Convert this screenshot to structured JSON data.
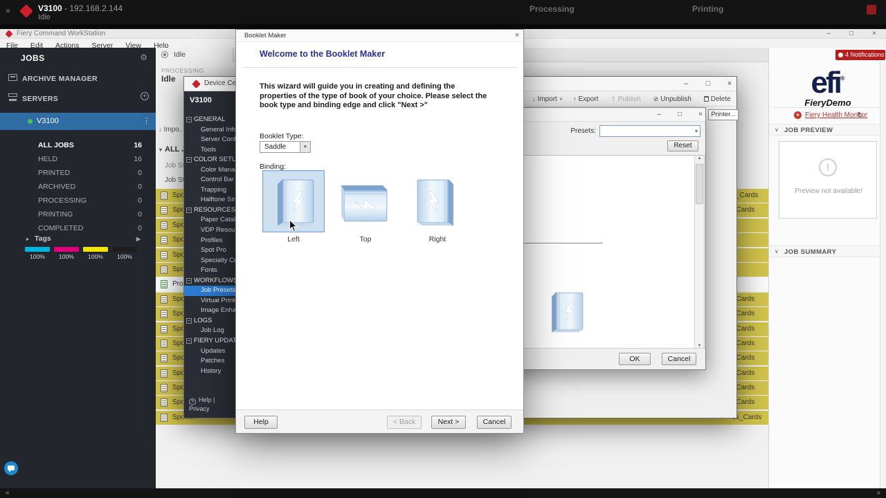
{
  "colors": {
    "fiery_red": "#cf1f2e",
    "selection_blue": "#2b7cd3",
    "server_selected_blue": "#2e6ca3",
    "heading_blue": "#2c2f8e",
    "job_row_yellow": "#d2c34c",
    "notification_red": "#b71c1c"
  },
  "system_bar": {
    "expand_icon": "»",
    "server_name": "V3100",
    "server_ip": "- 192.168.2.144",
    "status": "Idle",
    "processing_label": "Processing",
    "printing_label": "Printing"
  },
  "app_window": {
    "title": "Fiery Command WorkStation",
    "menus": [
      "File",
      "Edit",
      "Actions",
      "Server",
      "View",
      "Help"
    ]
  },
  "sidebar": {
    "jobs_header": "JOBS",
    "archive_manager_label": "ARCHIVE MANAGER",
    "servers_header": "SERVERS",
    "server_name": "V3100",
    "categories": [
      {
        "label": "ALL JOBS",
        "count": "16",
        "selected": true
      },
      {
        "label": "HELD",
        "count": "16"
      },
      {
        "label": "PRINTED",
        "count": "0"
      },
      {
        "label": "ARCHIVED",
        "count": "0"
      },
      {
        "label": "PROCESSING",
        "count": "0"
      },
      {
        "label": "PRINTING",
        "count": "0"
      },
      {
        "label": "COMPLETED",
        "count": "0"
      }
    ],
    "tags_label": "Tags",
    "ink_levels": [
      {
        "name": "cyan",
        "color": "#00b5e2",
        "percent": "100%"
      },
      {
        "name": "magenta",
        "color": "#e6007e",
        "percent": "100%"
      },
      {
        "name": "yellow",
        "color": "#f2e400",
        "percent": "100%"
      },
      {
        "name": "black",
        "color": "#1f1f1f",
        "percent": "100%"
      }
    ]
  },
  "job_center": {
    "tab_label": "Idle",
    "processing_label": "PROCESSING",
    "status": "Idle",
    "import_button_label": "Impo...",
    "group_header": "ALL J...",
    "column_header_top": "Job Status",
    "column_header": "Job Status",
    "rows": [
      {
        "label": "Spoo...",
        "name": "s_Cards",
        "type": "spooled"
      },
      {
        "label": "Spoo...",
        "name": "_Cards",
        "type": "spooled"
      },
      {
        "label": "Spoo...",
        "name": "",
        "type": "spooled"
      },
      {
        "label": "Spoo...",
        "name": "",
        "type": "spooled"
      },
      {
        "label": "Spoo...",
        "name": "",
        "type": "spooled"
      },
      {
        "label": "Spoo...",
        "name": "",
        "type": "spooled"
      },
      {
        "label": "Proc...",
        "name": "",
        "type": "processed"
      },
      {
        "label": "Spoo...",
        "name": "_Cards",
        "type": "spooled"
      },
      {
        "label": "Spoo...",
        "name": "_Cards",
        "type": "spooled"
      },
      {
        "label": "Spoo...",
        "name": "_Cards",
        "type": "spooled"
      },
      {
        "label": "Spoo...",
        "name": "_Cards",
        "type": "spooled"
      },
      {
        "label": "Spoo...",
        "name": "_Cards",
        "type": "spooled"
      },
      {
        "label": "Spoo...",
        "name": "_Cards",
        "type": "spooled"
      },
      {
        "label": "Spoo...",
        "name": "_Cards",
        "type": "spooled"
      },
      {
        "label": "Spoo...",
        "name": "_Cards",
        "type": "spooled"
      },
      {
        "label": "Spoo...",
        "name": "ss_Cards",
        "type": "spooled"
      }
    ]
  },
  "device_center": {
    "window_title": "Device Center",
    "server_name": "V3100",
    "toolbar": [
      {
        "name": "import-button",
        "label": "Import",
        "glyph": "↓",
        "caret": "∨"
      },
      {
        "name": "export-button",
        "label": "Export",
        "glyph": "↑"
      },
      {
        "name": "publish-button",
        "label": "Publish",
        "glyph": "⇑",
        "disabled": true
      },
      {
        "name": "unpublish-button",
        "label": "Unpublish",
        "glyph": "⊘"
      },
      {
        "name": "delete-button",
        "label": "Delete",
        "glyph": ""
      }
    ],
    "printer_button_label": "Printer...",
    "tree": [
      {
        "section": "GENERAL",
        "items": [
          {
            "label": "General Info"
          },
          {
            "label": "Server Configur..."
          },
          {
            "label": "Tools"
          }
        ]
      },
      {
        "section": "COLOR SETUP",
        "items": [
          {
            "label": "Color Manager..."
          },
          {
            "label": "Control Bar"
          },
          {
            "label": "Trapping"
          },
          {
            "label": "Halftone Simul..."
          }
        ]
      },
      {
        "section": "RESOURCES",
        "items": [
          {
            "label": "Paper Catalog"
          },
          {
            "label": "VDP Resources"
          },
          {
            "label": "Profiles"
          },
          {
            "label": "Spot Pro"
          },
          {
            "label": "Specialty Colors"
          },
          {
            "label": "Fonts"
          }
        ]
      },
      {
        "section": "WORKFLOWS",
        "items": [
          {
            "label": "Job Presets",
            "selected": true
          },
          {
            "label": "Virtual Printers"
          },
          {
            "label": "Image Enhance..."
          }
        ]
      },
      {
        "section": "LOGS",
        "items": [
          {
            "label": "Job Log"
          }
        ]
      },
      {
        "section": "FIERY UPDATES",
        "items": [
          {
            "label": "Updates"
          },
          {
            "label": "Patches"
          },
          {
            "label": "History"
          }
        ]
      }
    ],
    "footer_help": "Help",
    "footer_divider": "|",
    "footer_privacy": "Privacy"
  },
  "printer_dialog": {
    "presets_label": "Presets:",
    "reset_button": "Reset",
    "ok_button": "OK",
    "cancel_button": "Cancel"
  },
  "booklet_maker": {
    "window_title": "Booklet Maker",
    "heading": "Welcome to the Booklet Maker",
    "description": "This wizard will guide you in creating and defining the properties of the type of book of your choice. Please select the book type and binding edge and click \"Next >\"",
    "booklet_type_label": "Booklet Type:",
    "booklet_type_value": "Saddle",
    "binding_label": "Binding:",
    "bindings": [
      {
        "label": "Left",
        "orientation": "left",
        "selected": true
      },
      {
        "label": "Top",
        "orientation": "top"
      },
      {
        "label": "Right",
        "orientation": "right"
      }
    ],
    "help_button": "Help",
    "back_button": "< Back",
    "next_button": "Next >",
    "cancel_button": "Cancel"
  },
  "right_panel": {
    "notifications_badge": "4 Notifications",
    "logo_text": "efi",
    "logo_reg": "®",
    "logo_subtext": "FieryDemo",
    "health_monitor_link": "Fiery Health Monitor",
    "refresh_icon": "↻",
    "job_preview_header": "JOB PREVIEW",
    "preview_message": "Preview not available!",
    "job_summary_header": "JOB SUMMARY"
  },
  "bottom_bar": {
    "left_icon": "«",
    "right_icon": "»"
  }
}
